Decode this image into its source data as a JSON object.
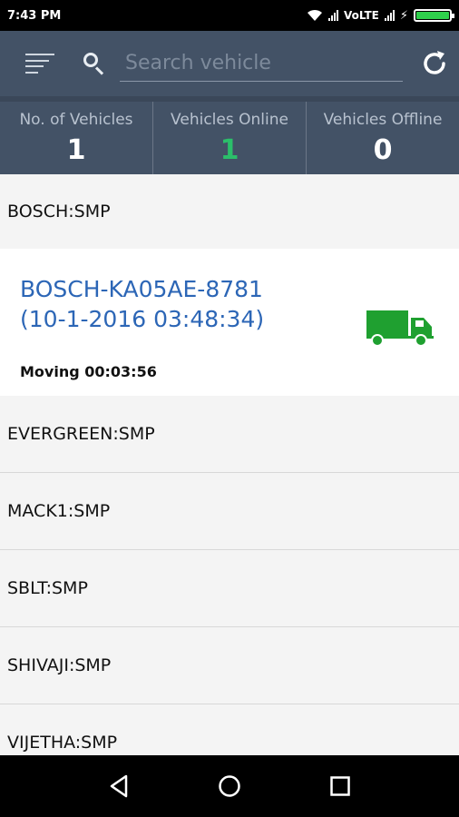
{
  "status_bar": {
    "time": "7:43 PM",
    "network": "VoLTE"
  },
  "header": {
    "search": {
      "placeholder": "Search vehicle",
      "value": ""
    }
  },
  "stats": [
    {
      "label": "No. of Vehicles",
      "value": "1"
    },
    {
      "label": "Vehicles Online",
      "value": "1"
    },
    {
      "label": "Vehicles Offline",
      "value": "0"
    }
  ],
  "groups": [
    {
      "name": "BOSCH:SMP"
    },
    {
      "name": "EVERGREEN:SMP"
    },
    {
      "name": "MACK1:SMP"
    },
    {
      "name": "SBLT:SMP"
    },
    {
      "name": "SHIVAJI:SMP"
    },
    {
      "name": "VIJETHA:SMP"
    }
  ],
  "vehicle": {
    "title": "BOSCH-KA05AE-8781",
    "timestamp": "(10-1-2016 03:48:34)",
    "status": "Moving 00:03:56",
    "icon": "truck-icon",
    "icon_color": "#1fa030"
  },
  "colors": {
    "header_bg": "#435266",
    "online_green": "#2bbf6a",
    "link_blue": "#2c66b6"
  }
}
